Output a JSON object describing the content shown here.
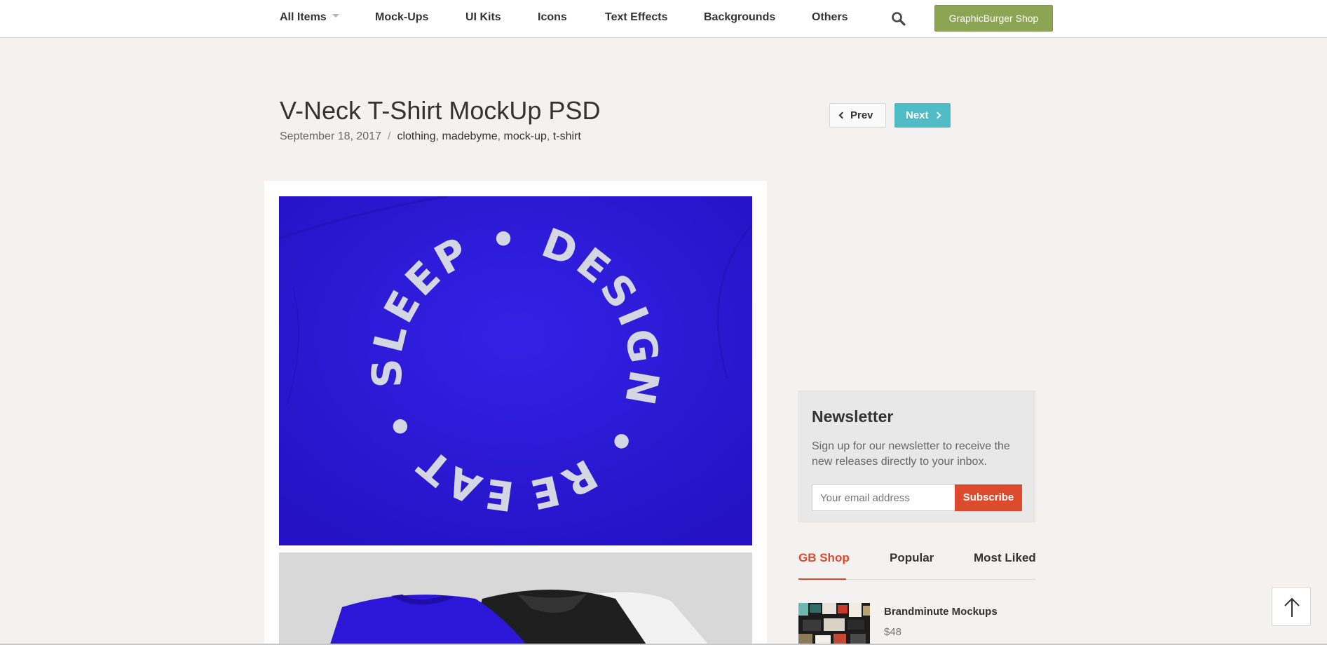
{
  "nav": {
    "items": [
      "All Items",
      "Mock-Ups",
      "UI Kits",
      "Icons",
      "Text Effects",
      "Backgrounds",
      "Others"
    ],
    "shop_label": "GraphicBurger Shop",
    "icons": {
      "search": "search-icon",
      "caret": "caret-down-icon"
    }
  },
  "post": {
    "title": "V-Neck T-Shirt MockUp PSD",
    "date": "September 18, 2017",
    "separator": "/",
    "tags": [
      "clothing",
      "madebyme",
      "mock-up",
      "t-shirt"
    ],
    "prev_label": "Prev",
    "next_label": "Next",
    "hero_text": "EAT • SLEEP • DESIGN • REPEAT •"
  },
  "newsletter": {
    "title": "Newsletter",
    "description": "Sign up for our newsletter to receive the new releases directly to your inbox.",
    "email_placeholder": "Your email address",
    "subscribe_label": "Subscribe"
  },
  "tabs": {
    "items": [
      "GB Shop",
      "Popular",
      "Most Liked"
    ],
    "active": "GB Shop"
  },
  "product": {
    "name": "Brandminute Mockups",
    "price": "$48"
  },
  "colors": {
    "accent_red": "#de4a2c",
    "shop_green": "#8ca552",
    "next_teal": "#4fbcc6",
    "shirt_blue": "#2b18d8"
  }
}
